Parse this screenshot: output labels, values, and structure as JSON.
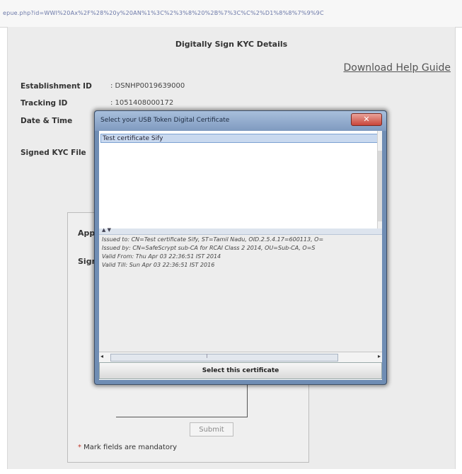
{
  "browser": {
    "url": "epue.php?id=WWI%20Ax%2F%28%20y%20AN%1%3C%2%3%8%20%2B%7%3C%C%2%D1%8%8%7%9%9C"
  },
  "page": {
    "heading": "Digitally Sign KYC Details",
    "help_link": "Download Help Guide",
    "fields": {
      "establishment_id_label": "Establishment ID",
      "establishment_id_value": ": DSNHP0019639000",
      "tracking_id_label": "Tracking ID",
      "tracking_id_value": ": 1051408000172",
      "date_time_label": "Date & Time",
      "signed_kyc_label": "Signed KYC File"
    },
    "form": {
      "partial_label_1": "Appi",
      "partial_label_2": "Sign",
      "submit_label": "Submit",
      "mandatory_star": "*",
      "mandatory_note": " Mark fields are mandatory"
    }
  },
  "dialog": {
    "title": "Select your USB Token Digital Certificate",
    "close_label": "✕",
    "certificates": [
      "Test certificate Sify"
    ],
    "splitter_arrows": "▲ ▼",
    "details": [
      "Issued to: CN=Test certificate Sify, ST=Tamil Nadu, OID.2.5.4.17=600113, O=",
      "Issued by: CN=SafeScrypt sub-CA for RCAI Class 2 2014, OU=Sub-CA, O=S",
      "Valid From: Thu Apr 03 22:36:51 IST 2014",
      "Valid Till: Sun Apr 03 22:36:51 IST 2016"
    ],
    "select_button": "Select this certificate"
  }
}
